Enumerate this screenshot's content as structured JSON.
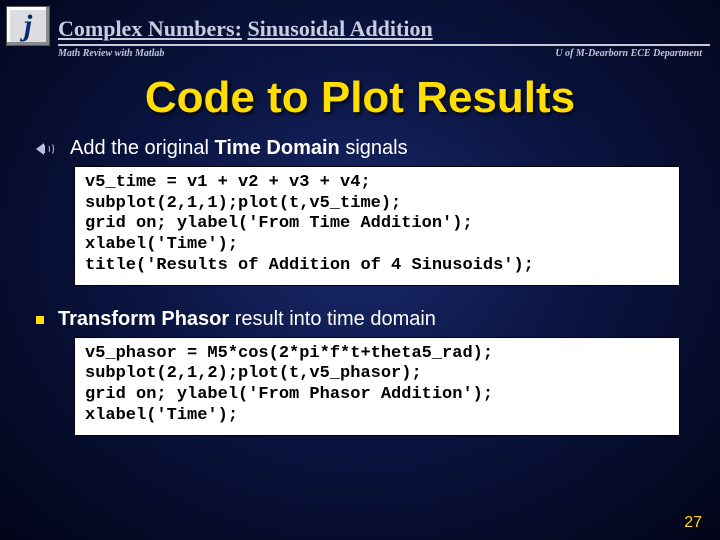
{
  "header": {
    "logo_letter": "j",
    "title_left": "Complex Numbers:",
    "title_right": "Sinusoidal Addition",
    "sub_left": "Math Review with Matlab",
    "sub_right": "U of M-Dearborn ECE Department"
  },
  "slide": {
    "title": "Code to Plot Results",
    "bullet1_pre": "Add the original ",
    "bullet1_bold": "Time Domain",
    "bullet1_post": " signals",
    "code1": "v5_time = v1 + v2 + v3 + v4;\nsubplot(2,1,1);plot(t,v5_time);\ngrid on; ylabel('From Time Addition');\nxlabel('Time');\ntitle('Results of Addition of 4 Sinusoids');",
    "bullet2_bold": "Transform Phasor",
    "bullet2_post": " result into time domain",
    "code2": "v5_phasor = M5*cos(2*pi*f*t+theta5_rad);\nsubplot(2,1,2);plot(t,v5_phasor);\ngrid on; ylabel('From Phasor Addition');\nxlabel('Time');",
    "pagenum": "27"
  }
}
